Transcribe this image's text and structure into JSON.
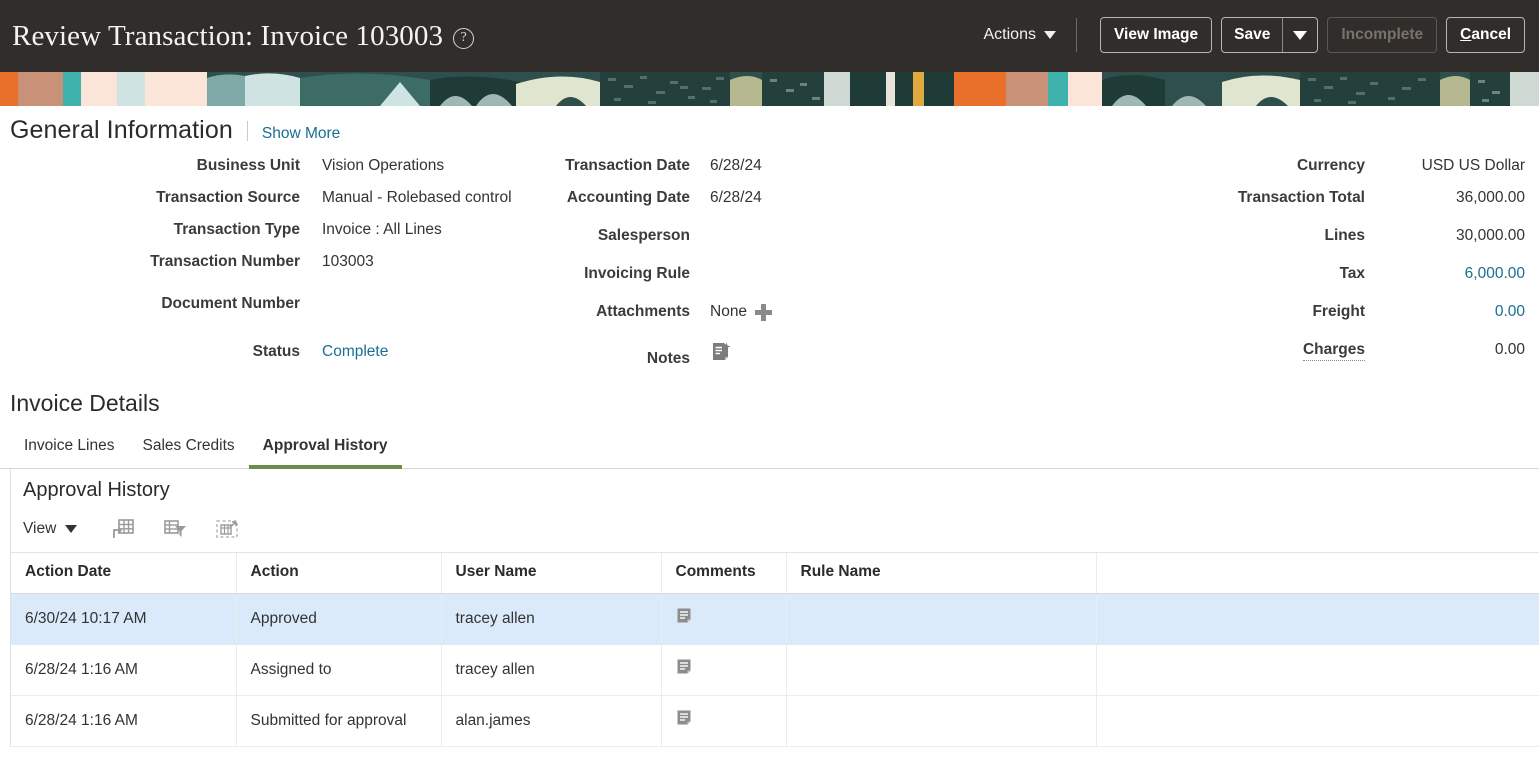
{
  "header": {
    "title": "Review Transaction: Invoice 103003",
    "help_icon": "help-circle-icon",
    "actions_label": "Actions",
    "view_image_label": "View Image",
    "save_label": "Save",
    "save_dropdown_icon": "chevron-down-icon",
    "incomplete_label": "Incomplete",
    "cancel_label_prefix": "C",
    "cancel_label_rest": "ancel",
    "background_color": "#312d2a"
  },
  "banner": {
    "name": "decorative-banner",
    "colors": [
      "#e8702a",
      "#c89178",
      "#3fb2ad",
      "#fbe4d8",
      "#7fa9a6",
      "#cfe3e3",
      "#2e4f4b",
      "#1f3b38",
      "#dfe5cf",
      "#e0a93f",
      "#c9d4cc"
    ]
  },
  "general_information": {
    "title": "General Information",
    "show_more_label": "Show More",
    "column1": [
      {
        "label": "Business Unit",
        "value": "Vision Operations"
      },
      {
        "label": "Transaction Source",
        "value": "Manual - Rolebased control"
      },
      {
        "label": "Transaction Type",
        "value": "Invoice : All Lines"
      },
      {
        "label": "Transaction Number",
        "value": "103003"
      },
      {
        "label": "Document Number",
        "value": ""
      },
      {
        "label": "Status",
        "value": "Complete",
        "is_link": true
      }
    ],
    "column2": [
      {
        "label": "Transaction Date",
        "value": "6/28/24"
      },
      {
        "label": "Accounting Date",
        "value": "6/28/24"
      },
      {
        "label": "Salesperson",
        "value": ""
      },
      {
        "label": "Invoicing Rule",
        "value": ""
      },
      {
        "label": "Attachments",
        "value": "None",
        "icon": "plus-icon"
      },
      {
        "label": "Notes",
        "value": "",
        "icon": "notes-document-icon"
      }
    ],
    "column3": [
      {
        "label": "Currency",
        "value": "USD US Dollar"
      },
      {
        "label": "Transaction Total",
        "value": "36,000.00"
      },
      {
        "label": "Lines",
        "value": "30,000.00"
      },
      {
        "label": "Tax",
        "value": "6,000.00",
        "is_link": true
      },
      {
        "label": "Freight",
        "value": "0.00",
        "is_link": true
      },
      {
        "label": "Charges",
        "value": "0.00",
        "dotted": true
      }
    ]
  },
  "invoice_details": {
    "title": "Invoice Details",
    "tabs": [
      {
        "label": "Invoice Lines",
        "active": false
      },
      {
        "label": "Sales Credits",
        "active": false
      },
      {
        "label": "Approval History",
        "active": true
      }
    ],
    "active_tab_accent": "#6b8e4e"
  },
  "approval_history": {
    "panel_title": "Approval History",
    "toolbar": {
      "view_label": "View",
      "view_caret_icon": "chevron-down-icon",
      "icons": [
        {
          "name": "export-to-spreadsheet-icon"
        },
        {
          "name": "filter-table-icon"
        },
        {
          "name": "detach-table-icon"
        }
      ]
    },
    "columns": [
      "Action Date",
      "Action",
      "User Name",
      "Comments",
      "Rule Name"
    ],
    "rows": [
      {
        "action_date": "6/30/24 10:17 AM",
        "action": "Approved",
        "user_name": "tracey allen",
        "comments_icon": "comment-note-icon",
        "rule_name": "",
        "selected": true
      },
      {
        "action_date": "6/28/24 1:16 AM",
        "action": "Assigned to",
        "user_name": "tracey allen",
        "comments_icon": "comment-note-icon",
        "rule_name": "",
        "selected": false
      },
      {
        "action_date": "6/28/24 1:16 AM",
        "action": "Submitted for approval",
        "user_name": "alan.james",
        "comments_icon": "comment-note-icon",
        "rule_name": "",
        "selected": false
      }
    ],
    "selected_row_color": "#dbeafb"
  },
  "theme": {
    "link_color": "#1a6e92",
    "text_color": "#333333",
    "label_color": "#3b3b3b"
  }
}
